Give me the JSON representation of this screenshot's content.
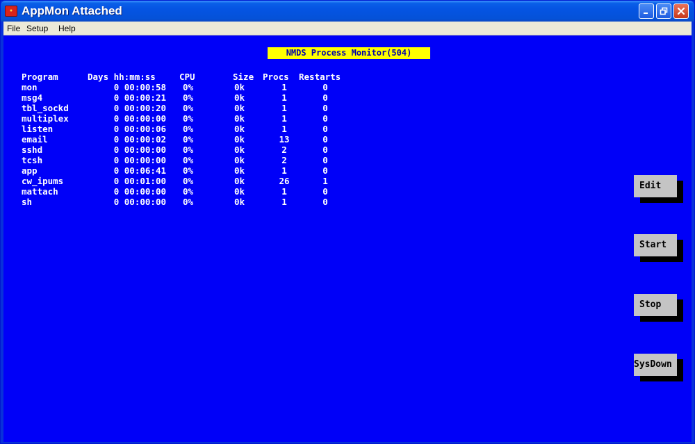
{
  "window": {
    "title": "AppMon Attached",
    "icon": "appmon-logo-icon",
    "controls": [
      "minimize-icon",
      "restore-icon",
      "close-icon"
    ]
  },
  "menu": {
    "file": "File",
    "setup": "Setup",
    "help": "Help"
  },
  "banner": "NMDS Process Monitor(504)",
  "table": {
    "headers": {
      "program": "Program",
      "time": "Days hh:mm:ss",
      "cpu": "CPU",
      "size": "Size",
      "procs": "Procs",
      "restarts": "Restarts"
    },
    "rows": [
      {
        "program": "mon",
        "time": "0 00:00:58",
        "cpu": "0%",
        "size": "0k",
        "procs": "1",
        "restarts": "0"
      },
      {
        "program": "msg4",
        "time": "0 00:00:21",
        "cpu": "0%",
        "size": "0k",
        "procs": "1",
        "restarts": "0"
      },
      {
        "program": "tbl_sockd",
        "time": "0 00:00:20",
        "cpu": "0%",
        "size": "0k",
        "procs": "1",
        "restarts": "0"
      },
      {
        "program": "multiplex",
        "time": "0 00:00:00",
        "cpu": "0%",
        "size": "0k",
        "procs": "1",
        "restarts": "0"
      },
      {
        "program": "listen",
        "time": "0 00:00:06",
        "cpu": "0%",
        "size": "0k",
        "procs": "1",
        "restarts": "0"
      },
      {
        "program": "email",
        "time": "0 00:00:02",
        "cpu": "0%",
        "size": "0k",
        "procs": "13",
        "restarts": "0"
      },
      {
        "program": "sshd",
        "time": "0 00:00:00",
        "cpu": "0%",
        "size": "0k",
        "procs": "2",
        "restarts": "0"
      },
      {
        "program": "tcsh",
        "time": "0 00:00:00",
        "cpu": "0%",
        "size": "0k",
        "procs": "2",
        "restarts": "0"
      },
      {
        "program": "app",
        "time": "0 00:06:41",
        "cpu": "0%",
        "size": "0k",
        "procs": "1",
        "restarts": "0"
      },
      {
        "program": "cw_ipums",
        "time": "0 00:01:00",
        "cpu": "0%",
        "size": "0k",
        "procs": "26",
        "restarts": "1"
      },
      {
        "program": "mattach",
        "time": "0 00:00:00",
        "cpu": "0%",
        "size": "0k",
        "procs": "1",
        "restarts": "0"
      },
      {
        "program": "sh",
        "time": "0 00:00:00",
        "cpu": "0%",
        "size": "0k",
        "procs": "1",
        "restarts": "0"
      }
    ]
  },
  "buttons": {
    "edit": "Edit",
    "start": "Start",
    "stop": "Stop",
    "sysdown": "SysDown"
  },
  "colors": {
    "background": "#0000f8",
    "banner": "#ffff00",
    "button": "#c4c4c4",
    "titlebar": "#0554e3"
  }
}
